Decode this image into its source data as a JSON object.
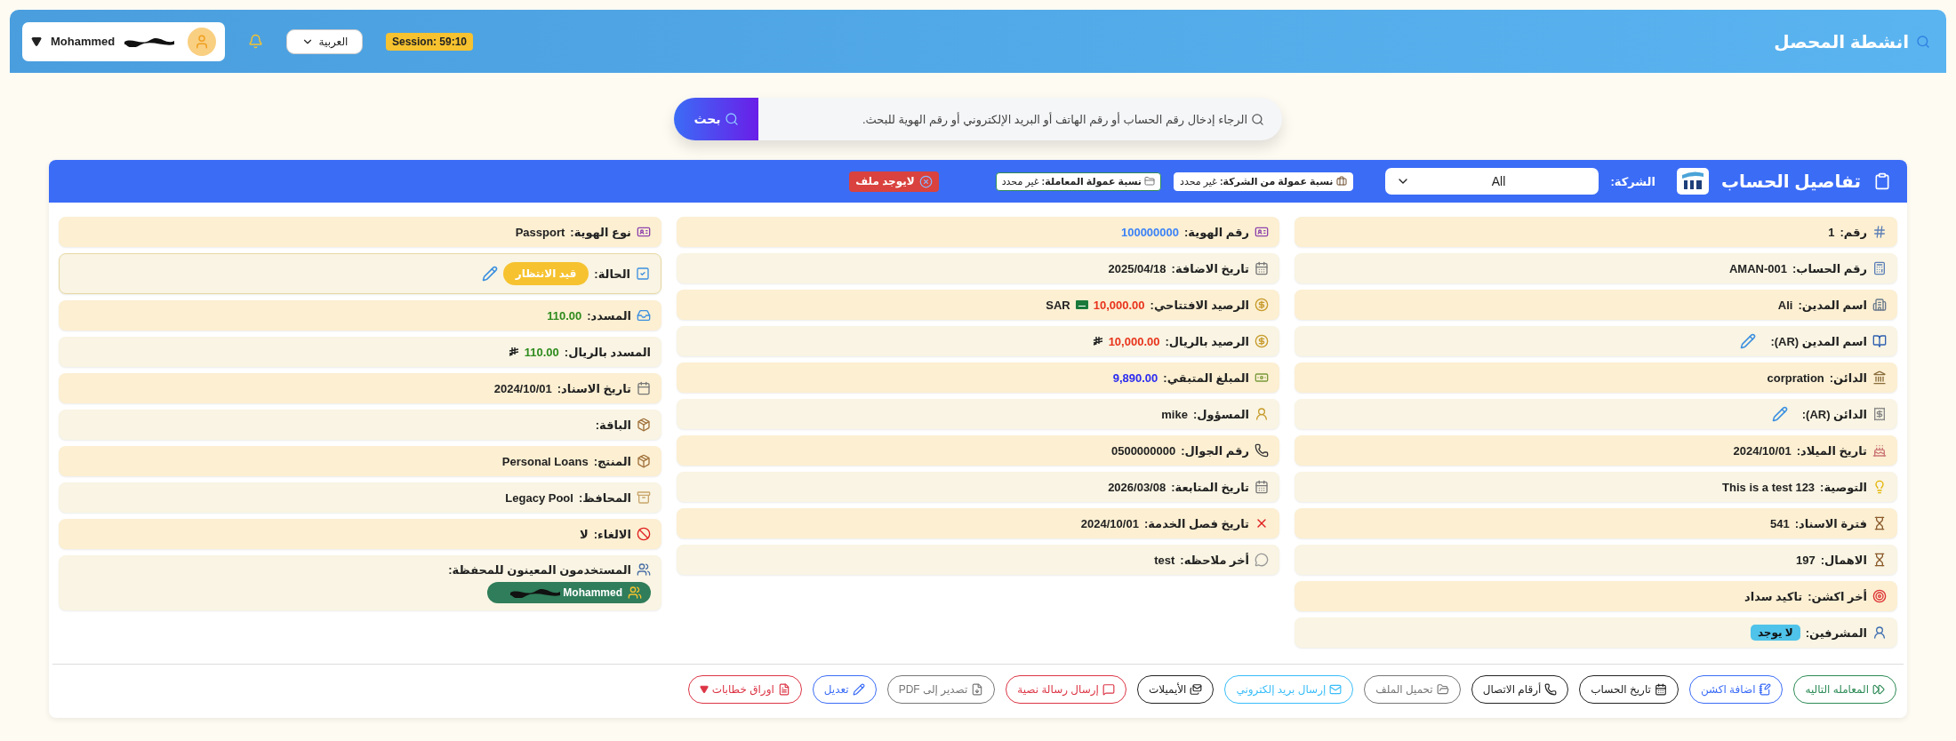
{
  "header": {
    "title": "انشطة المحصل",
    "session": "Session: 59:10",
    "language": "العربية",
    "user": "Mohammed"
  },
  "search": {
    "placeholder": "الرجاء إدخال رقم الحساب أو رقم الهاتف أو البريد الإلكتروني أو رقم الهوية للبحث.",
    "button": "بحث"
  },
  "account": {
    "title": "تفاصيل الحساب",
    "company_label": "الشركة:",
    "company_value": "All",
    "badges": [
      {
        "label": "نسبة عمولة من الشركة:",
        "value": "غير محدد"
      },
      {
        "label": "نسبة عمولة المعاملة:",
        "value": "غير محدد"
      }
    ],
    "file_badge": "لايوجد ملف"
  },
  "columns": [
    [
      {
        "kind": "text",
        "label": "رقم:",
        "value": "1"
      },
      {
        "kind": "text",
        "label": "رقم الحساب:",
        "value": "AMAN-001"
      },
      {
        "kind": "text",
        "label": "اسم المدين:",
        "value": "Ali"
      },
      {
        "kind": "edit",
        "label": "اسم المدين (AR):"
      },
      {
        "kind": "text",
        "label": "الدائن:",
        "value": "corpration"
      },
      {
        "kind": "edit",
        "label": "الدائن (AR):"
      },
      {
        "kind": "text",
        "label": "تاريخ الميلاد:",
        "value": "2024/10/01"
      },
      {
        "kind": "text",
        "label": "التوصية:",
        "value": "This is a test 123"
      },
      {
        "kind": "text",
        "label": "فترة الاسناد:",
        "value": "541"
      },
      {
        "kind": "text",
        "label": "الاهمال:",
        "value": "197"
      },
      {
        "kind": "text",
        "label": "أخر اكشن:",
        "value": "تاكيد سداد"
      },
      {
        "kind": "tag",
        "label": "المشرفين:",
        "value": "لا يوجد"
      }
    ],
    [
      {
        "kind": "text",
        "label": "رقم الهوية:",
        "value": "100000000",
        "color": "#3b82f6"
      },
      {
        "kind": "text",
        "label": "تاريخ الاضافة:",
        "value": "2025/04/18"
      },
      {
        "kind": "text",
        "label": "الرصيد الافتتاحي:",
        "value": "10,000.00",
        "color": "#e8341c",
        "currency": {
          "kind": "sar",
          "text": "SAR"
        }
      },
      {
        "kind": "text",
        "label": "الرصيد بالريال:",
        "value": "10,000.00",
        "color": "#e8341c",
        "currency": {
          "kind": "riyal"
        }
      },
      {
        "kind": "text",
        "label": "المبلغ المتبقي:",
        "value": "9,890.00",
        "color": "#2b2bf0"
      },
      {
        "kind": "text",
        "label": "المسؤول:",
        "value": "mike"
      },
      {
        "kind": "text",
        "label": "رقم الجوال:",
        "value": "0500000000"
      },
      {
        "kind": "text",
        "label": "تاريخ المتابعة:",
        "value": "2026/03/08"
      },
      {
        "kind": "text",
        "label": "تاريخ فصل الخدمة:",
        "value": "2024/10/01"
      },
      {
        "kind": "text",
        "label": "أخر ملاحظه:",
        "value": "test"
      }
    ],
    [
      {
        "kind": "text",
        "label": "نوع الهوية:",
        "value": "Passport"
      },
      {
        "kind": "status",
        "label": "الحالة:",
        "value": "قيد الانتظار"
      },
      {
        "kind": "text",
        "label": "المسدد:",
        "value": "110.00",
        "color": "#2e8b1e"
      },
      {
        "kind": "text",
        "label": "المسدد بالريال:",
        "value": "110.00",
        "color": "#2e8b1e",
        "currency": {
          "kind": "riyal"
        }
      },
      {
        "kind": "text",
        "label": "تاريخ الاسناد:",
        "value": "2024/10/01"
      },
      {
        "kind": "text",
        "label": "الباقة:"
      },
      {
        "kind": "text",
        "label": "المنتج:",
        "value": "Personal Loans"
      },
      {
        "kind": "text",
        "label": "المحافظ:",
        "value": "Legacy Pool"
      },
      {
        "kind": "text",
        "label": "الالغاء:",
        "value": "لا"
      },
      {
        "kind": "users",
        "label": "المستخدمون المعينون للمحفظة:",
        "users": [
          "Mohammed"
        ]
      }
    ]
  ],
  "buttons": [
    {
      "label": "المعامله التاليه",
      "color": "#2e8b57"
    },
    {
      "label": "اضافة اكشن",
      "color": "#3b6cf6"
    },
    {
      "label": "تاريخ الحساب",
      "color": "#222222"
    },
    {
      "label": "أرقام الاتصال",
      "color": "#222222"
    },
    {
      "label": "تحميل الملف",
      "color": "#777777"
    },
    {
      "label": "إرسال بريد إلكتروني",
      "color": "#38bdf8"
    },
    {
      "label": "الأيميلات",
      "color": "#222222"
    },
    {
      "label": "إرسال رسالة نصية",
      "color": "#dc3545"
    },
    {
      "label": "تصدير إلى PDF",
      "color": "#777777"
    },
    {
      "label": "تعديل",
      "color": "#3b6cf6"
    },
    {
      "label": "اوراق خطابات",
      "color": "#dc3545"
    }
  ]
}
